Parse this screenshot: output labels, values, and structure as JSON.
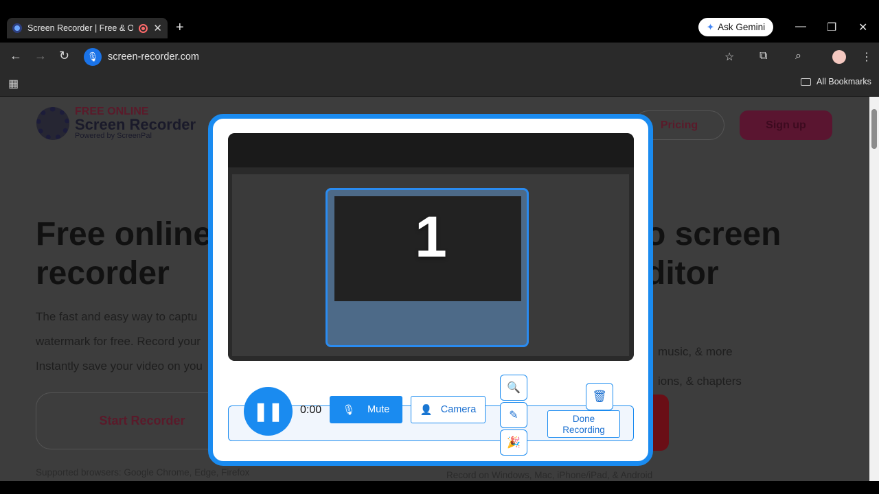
{
  "browser": {
    "tab_title": "Screen Recorder | Free & O",
    "url": "screen-recorder.com",
    "ask_gemini": "Ask Gemini",
    "all_bookmarks": "All Bookmarks"
  },
  "site": {
    "logo_line1": "FREE ONLINE",
    "logo_line2": "Screen Recorder",
    "logo_line3": "Powered by ScreenPal",
    "pricing": "Pricing",
    "signup": "Sign up",
    "headline_left_1": "Free online",
    "headline_left_2": "recorder",
    "headline_right_1": "o screen",
    "headline_right_2": "ditor",
    "sub_1": "The fast and easy way to captu",
    "sub_2": "watermark for free. Record your",
    "sub_3": "Instantly save your video on you",
    "sub_right_1": "music, & more",
    "sub_right_2": "ions, & chapters",
    "start_recorder": "Start Recorder",
    "supported": "Supported browsers: Google Chrome, Edge, Firefox",
    "supported_right": "Record on Windows, Mac, iPhone/iPad, & Android"
  },
  "recorder": {
    "countdown": "1",
    "timer": "0:00",
    "mute": "Mute",
    "camera": "Camera",
    "done_line1": "Done",
    "done_line2": "Recording"
  },
  "icons": [
    "screenpal-favicon",
    "record-indicator-icon",
    "close-icon",
    "plus-icon",
    "gemini-star-icon",
    "minimize-icon",
    "restore-icon",
    "back-icon",
    "forward-icon",
    "reload-icon",
    "mic-icon",
    "star-icon",
    "extensions-icon",
    "tab-search-icon",
    "more-icon",
    "apps-icon",
    "folder-icon",
    "pause-icon",
    "camera-icon",
    "zoom-icon",
    "pen-icon",
    "effects-icon",
    "trash-icon"
  ],
  "colors": {
    "accent": "#1a8bf0",
    "brand_dark": "#5a1530",
    "overlay_bg": "#3d3d3d"
  }
}
